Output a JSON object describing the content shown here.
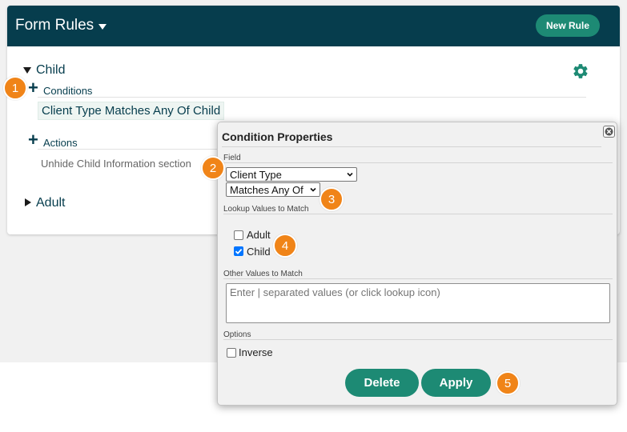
{
  "header": {
    "title": "Form Rules",
    "new_rule_label": "New Rule"
  },
  "rules": {
    "child": {
      "label": "Child",
      "conditions_label": "Conditions",
      "condition_text": "Client Type Matches Any Of Child",
      "actions_label": "Actions",
      "action_text": "Unhide Child Information section"
    },
    "adult": {
      "label": "Adult"
    }
  },
  "dialog": {
    "title": "Condition Properties",
    "field_section": "Field",
    "field_value": "Client Type",
    "operator_value": "Matches Any Of",
    "lookup_section": "Lookup Values to Match",
    "lookup_options": [
      {
        "label": "Adult",
        "checked": false
      },
      {
        "label": "Child",
        "checked": true
      }
    ],
    "other_section": "Other Values to Match",
    "other_placeholder": "Enter | separated values (or click lookup icon)",
    "options_section": "Options",
    "inverse_label": "Inverse",
    "inverse_checked": false,
    "delete_label": "Delete",
    "apply_label": "Apply"
  },
  "badges": [
    "1",
    "2",
    "3",
    "4",
    "5"
  ],
  "colors": {
    "header_bg": "#063d4d",
    "accent": "#1d8a74",
    "badge": "#f08418"
  },
  "icons": {
    "settings": "gear-icon",
    "close": "close-icon",
    "add": "plus-icon"
  }
}
